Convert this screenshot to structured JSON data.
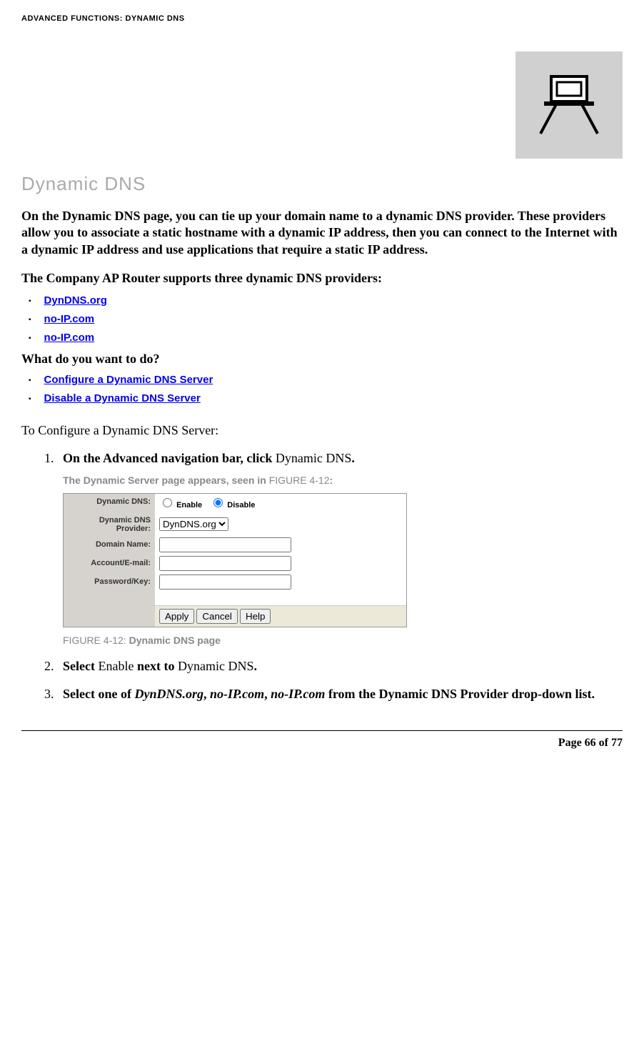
{
  "header": "ADVANCED FUNCTIONS: DYNAMIC DNS",
  "title": "Dynamic DNS",
  "intro": "On the Dynamic DNS page, you can tie up your domain name to a dynamic DNS provider. These providers allow you to associate a static hostname with a dynamic IP address, then you can connect to the Internet with a dynamic IP address and use applications that require a static IP address.",
  "supports": "The Company AP Router supports three dynamic DNS providers:",
  "providers": [
    "DynDNS.org",
    "no-IP.com",
    "no-IP.com"
  ],
  "question": "What do you want to do?",
  "actions": [
    "Configure a Dynamic DNS Server",
    "Disable a Dynamic DNS Server"
  ],
  "section_head": "To Configure a Dynamic DNS Server:",
  "steps": {
    "s1_prefix": "On the Advanced navigation bar, click ",
    "s1_action": "Dynamic DNS",
    "s1_suffix": ".",
    "fig_intro_prefix": "The Dynamic Server page appears, seen in ",
    "fig_intro_ref": "FIGURE 4-12",
    "fig_intro_suffix": ":",
    "fig_caption_num": "FIGURE 4-12: ",
    "fig_caption_title": "Dynamic DNS page",
    "s2_prefix": "Select ",
    "s2_mid1": "Enable",
    "s2_mid2": " next to ",
    "s2_mid3": "Dynamic DNS",
    "s2_suffix": ".",
    "s3_prefix": "Select one of ",
    "s3_p1": "DynDNS.org",
    "s3_c1": ", ",
    "s3_p2": "no-IP.com",
    "s3_c2": ", ",
    "s3_p3": "no-IP.com",
    "s3_suffix": " from the Dynamic DNS Provider drop-down list."
  },
  "screenshot": {
    "labels": {
      "ddns": "Dynamic DNS:",
      "provider": "Dynamic DNS Provider:",
      "domain": "Domain Name:",
      "account": "Account/E-mail:",
      "password": "Password/Key:"
    },
    "radio_enable": "Enable",
    "radio_disable": "Disable",
    "radio_selected": "disable",
    "provider_selected": "DynDNS.org",
    "domain_value": "",
    "account_value": "",
    "password_value": "",
    "buttons": {
      "apply": "Apply",
      "cancel": "Cancel",
      "help": "Help"
    }
  },
  "footer": "Page 66 of 77"
}
